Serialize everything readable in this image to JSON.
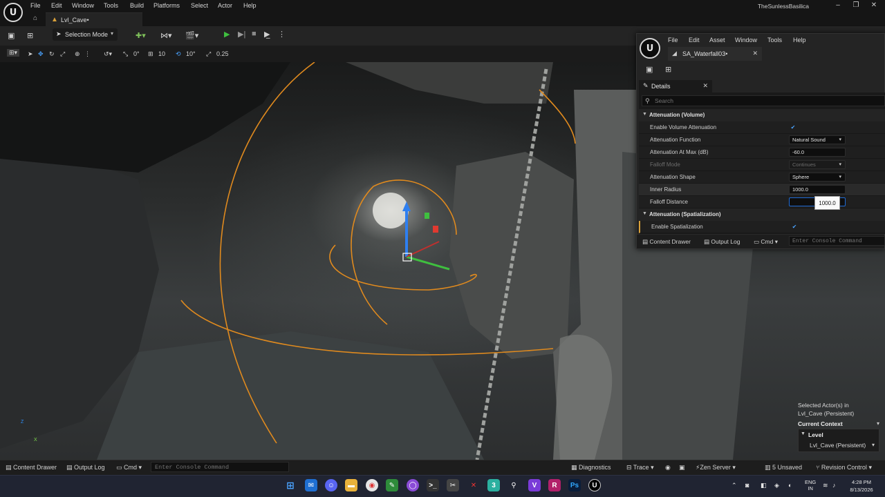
{
  "main_menu": [
    "File",
    "Edit",
    "Window",
    "Tools",
    "Build",
    "Platforms",
    "Select",
    "Actor",
    "Help"
  ],
  "project_name": "TheSunlessBasilica",
  "logo_text": "U",
  "level_tab": {
    "label": "Lvl_Cave•"
  },
  "toolbar": {
    "selection_mode": "Selection Mode"
  },
  "viewport_toolbar": {
    "rotate_snap_value": "0°",
    "grid_value": "10",
    "angle_snap_value": "10°",
    "scale_snap_value": "0.25"
  },
  "selected_actors": {
    "line1": "Selected Actor(s) in",
    "line2": "Lvl_Cave (Persistent)",
    "context_label": "Current Context",
    "level_label": "Level",
    "level_value": "Lvl_Cave (Persistent)"
  },
  "status_bar": {
    "content_drawer": "Content Drawer",
    "output_log": "Output Log",
    "cmd": "Cmd",
    "console_placeholder": "Enter Console Command",
    "diagnostics": "Diagnostics",
    "trace": "Trace",
    "zen_server": "Zen Server",
    "unsaved": "5 Unsaved",
    "revision_control": "Revision Control"
  },
  "asset_editor": {
    "menu": [
      "File",
      "Edit",
      "Asset",
      "Window",
      "Tools",
      "Help"
    ],
    "tab_label": "SA_Waterfall03•",
    "details_tab": "Details",
    "search_placeholder": "Search",
    "sections": {
      "volume": "Attenuation (Volume)",
      "spatialization": "Attenuation (Spatialization)"
    },
    "props": {
      "enable_volume": {
        "label": "Enable Volume Attenuation",
        "checked": true
      },
      "function": {
        "label": "Attenuation Function",
        "value": "Natural Sound"
      },
      "at_max": {
        "label": "Attenuation At Max (dB)",
        "value": "-60.0"
      },
      "falloff_mode": {
        "label": "Falloff Mode",
        "value": "Continues"
      },
      "shape": {
        "label": "Attenuation Shape",
        "value": "Sphere"
      },
      "inner_radius": {
        "label": "Inner Radius",
        "value": "1000.0"
      },
      "falloff_distance": {
        "label": "Falloff Distance",
        "value": ""
      },
      "enable_spatialization": {
        "label": "Enable Spatialization",
        "checked": true
      }
    },
    "tooltip_value": "1000.0",
    "status": {
      "content_drawer": "Content Drawer",
      "output_log": "Output Log",
      "cmd": "Cmd",
      "console_placeholder": "Enter Console Command"
    }
  },
  "taskbar": {
    "lang_line1": "ENG",
    "lang_line2": "IN",
    "time": "4:28 PM",
    "date": "8/13/2026"
  },
  "colors": {
    "attenuation_sphere": "#e08a1e",
    "accent_blue": "#1e6bd6",
    "play_green": "#3fbf3f"
  }
}
